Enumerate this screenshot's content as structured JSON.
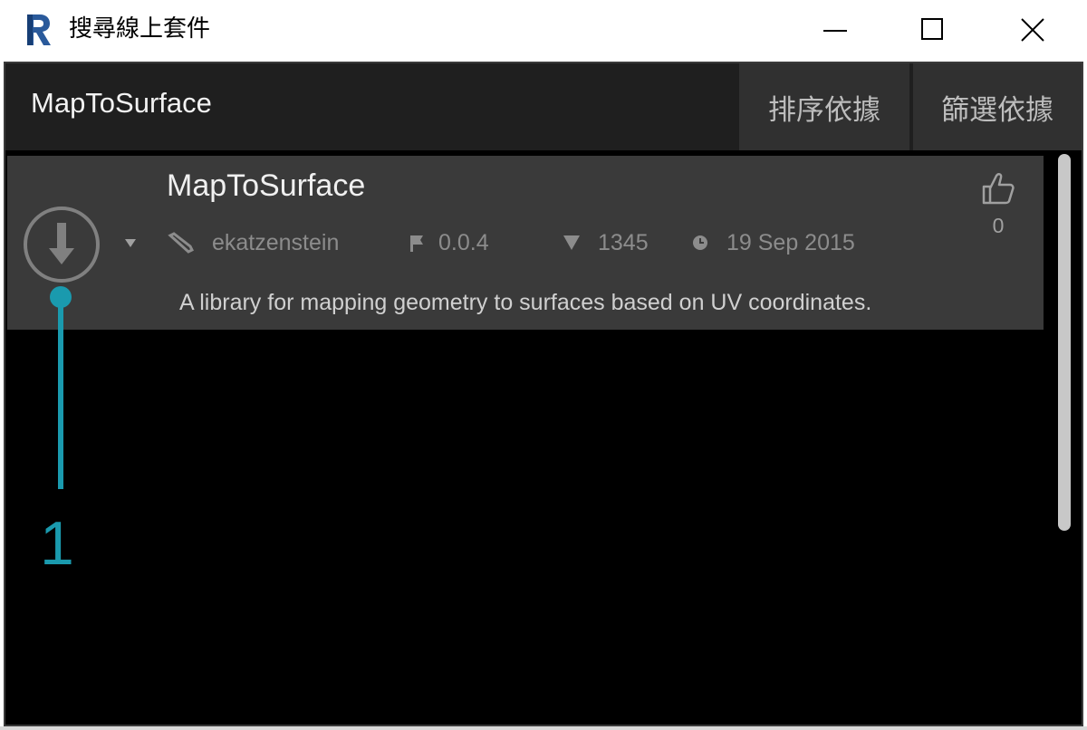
{
  "window": {
    "title": "搜尋線上套件",
    "app_icon": "revit-logo-icon",
    "controls": {
      "minimize": "minimize-icon",
      "maximize": "maximize-icon",
      "close": "close-icon"
    }
  },
  "header": {
    "search_value": "MapToSurface",
    "sort_label": "排序依據",
    "filter_label": "篩選依據"
  },
  "package": {
    "name": "MapToSurface",
    "author": "ekatzenstein",
    "version": "0.0.4",
    "downloads": "1345",
    "date": "19 Sep 2015",
    "description": "A library for mapping geometry to surfaces based on UV coordinates.",
    "likes": "0"
  },
  "callout": {
    "number": "1"
  },
  "colors": {
    "background": "#000000",
    "header": "#1f1f1f",
    "header_button": "#303030",
    "package_row": "#3a3a3a",
    "callout": "#1a9aae"
  }
}
